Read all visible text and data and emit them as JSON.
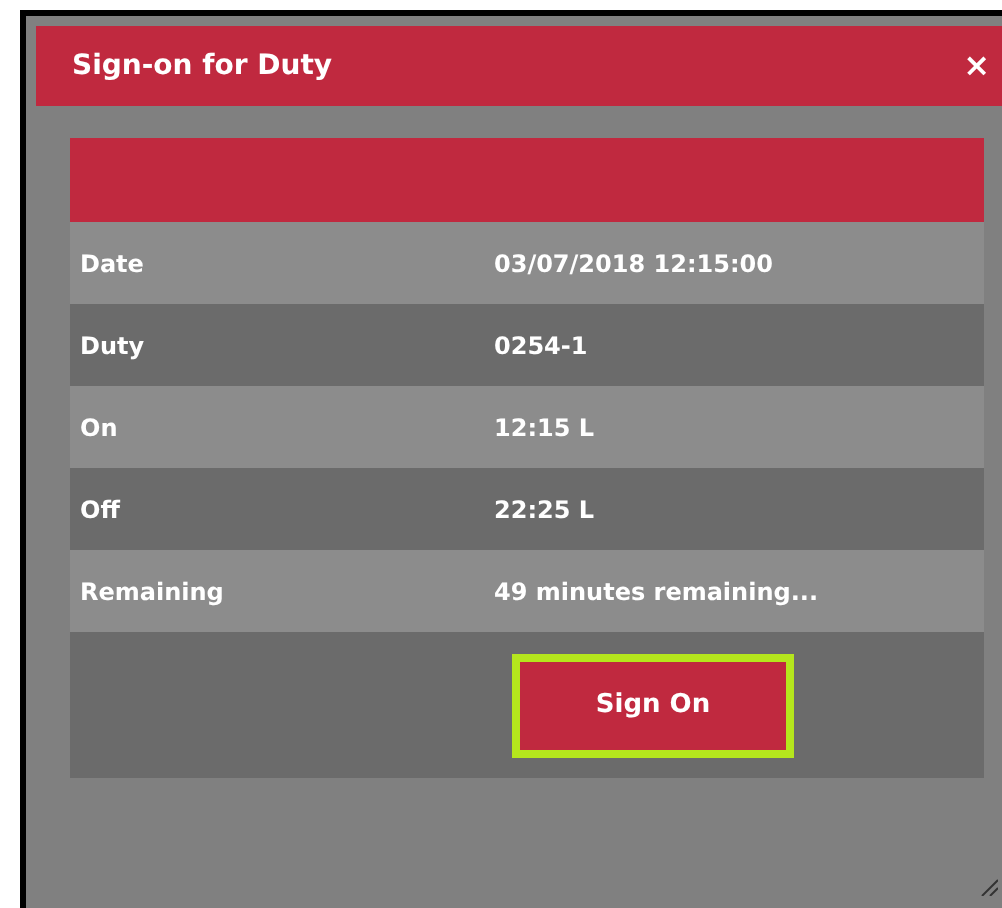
{
  "window": {
    "title": "Sign-on for Duty",
    "close": "×"
  },
  "rows": [
    {
      "label": "Date",
      "value": "03/07/2018 12:15:00"
    },
    {
      "label": "Duty",
      "value": "0254-1"
    },
    {
      "label": "On",
      "value": "12:15 L"
    },
    {
      "label": "Off",
      "value": "22:25 L"
    },
    {
      "label": "Remaining",
      "value": "49 minutes remaining..."
    }
  ],
  "button": {
    "label": "Sign On",
    "focused": true
  }
}
